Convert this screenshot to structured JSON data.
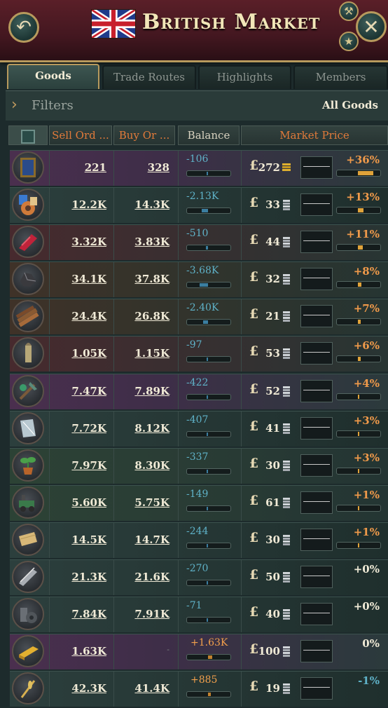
{
  "header": {
    "title": "British Market",
    "back_icon": "↶",
    "close_icon": "✕",
    "hammer_icon": "⚒",
    "star_icon": "★"
  },
  "tabs": [
    {
      "label": "Goods",
      "active": true
    },
    {
      "label": "Trade Routes",
      "active": false
    },
    {
      "label": "Highlights",
      "active": false
    },
    {
      "label": "Members",
      "active": false
    }
  ],
  "filters": {
    "label": "Filters",
    "value": "All Goods"
  },
  "columns": {
    "sell": "Sell Ord ...",
    "buy": "Buy Or ...",
    "balance": "Balance",
    "market_price": "Market Price"
  },
  "currency_symbol": "£",
  "goods": [
    {
      "icon": "painting-icon",
      "bg": "purple",
      "sell": "221",
      "buy": "328",
      "balance": "-106",
      "bal_level": 0.04,
      "bal_sign": "neg",
      "price": "272",
      "coin": "gold",
      "pct": "+36%",
      "pct_level": 0.36,
      "pct_type": "pos"
    },
    {
      "icon": "groceries-icon",
      "bg": "normal",
      "sell": "12.2K",
      "buy": "14.3K",
      "balance": "-2.13K",
      "bal_level": 0.15,
      "bal_sign": "neg",
      "price": "33",
      "coin": "silver",
      "pct": "+13%",
      "pct_level": 0.13,
      "pct_type": "pos"
    },
    {
      "icon": "fabric-icon",
      "bg": "red",
      "sell": "3.32K",
      "buy": "3.83K",
      "balance": "-510",
      "bal_level": 0.05,
      "bal_sign": "neg",
      "price": "44",
      "coin": "silver",
      "pct": "+11%",
      "pct_level": 0.11,
      "pct_type": "pos"
    },
    {
      "icon": "coal-icon",
      "bg": "brown",
      "sell": "34.1K",
      "buy": "37.8K",
      "balance": "-3.68K",
      "bal_level": 0.2,
      "bal_sign": "neg",
      "price": "32",
      "coin": "silver",
      "pct": "+8%",
      "pct_level": 0.08,
      "pct_type": "pos"
    },
    {
      "icon": "wood-icon",
      "bg": "brown",
      "sell": "24.4K",
      "buy": "26.8K",
      "balance": "-2.40K",
      "bal_level": 0.12,
      "bal_sign": "neg",
      "price": "21",
      "coin": "silver",
      "pct": "+7%",
      "pct_level": 0.07,
      "pct_type": "pos"
    },
    {
      "icon": "ammunition-icon",
      "bg": "red",
      "sell": "1.05K",
      "buy": "1.15K",
      "balance": "-97",
      "bal_level": 0.03,
      "bal_sign": "neg",
      "price": "53",
      "coin": "silver",
      "pct": "+6%",
      "pct_level": 0.06,
      "pct_type": "pos"
    },
    {
      "icon": "tools-icon",
      "bg": "purple",
      "sell": "7.47K",
      "buy": "7.89K",
      "balance": "-422",
      "bal_level": 0.04,
      "bal_sign": "neg",
      "price": "52",
      "coin": "silver",
      "pct": "+4%",
      "pct_level": 0.04,
      "pct_type": "pos"
    },
    {
      "icon": "glass-icon",
      "bg": "normal",
      "sell": "7.72K",
      "buy": "8.12K",
      "balance": "-407",
      "bal_level": 0.04,
      "bal_sign": "neg",
      "price": "41",
      "coin": "silver",
      "pct": "+3%",
      "pct_level": 0.03,
      "pct_type": "pos"
    },
    {
      "icon": "fertilizer-icon",
      "bg": "green",
      "sell": "7.97K",
      "buy": "8.30K",
      "balance": "-337",
      "bal_level": 0.04,
      "bal_sign": "neg",
      "price": "30",
      "coin": "silver",
      "pct": "+3%",
      "pct_level": 0.03,
      "pct_type": "pos"
    },
    {
      "icon": "engines-icon",
      "bg": "green",
      "sell": "5.60K",
      "buy": "5.75K",
      "balance": "-149",
      "bal_level": 0.03,
      "bal_sign": "neg",
      "price": "61",
      "coin": "silver",
      "pct": "+1%",
      "pct_level": 0.02,
      "pct_type": "pos"
    },
    {
      "icon": "paper-icon",
      "bg": "normal",
      "sell": "14.5K",
      "buy": "14.7K",
      "balance": "-244",
      "bal_level": 0.03,
      "bal_sign": "neg",
      "price": "30",
      "coin": "silver",
      "pct": "+1%",
      "pct_level": 0.02,
      "pct_type": "pos"
    },
    {
      "icon": "steel-icon",
      "bg": "normal",
      "sell": "21.3K",
      "buy": "21.6K",
      "balance": "-270",
      "bal_level": 0.03,
      "bal_sign": "neg",
      "price": "50",
      "coin": "silver",
      "pct": "+0%",
      "pct_level": 0,
      "pct_type": "zero"
    },
    {
      "icon": "iron-icon",
      "bg": "normal",
      "sell": "7.84K",
      "buy": "7.91K",
      "balance": "-71",
      "bal_level": 0.02,
      "bal_sign": "neg",
      "price": "40",
      "coin": "silver",
      "pct": "+0%",
      "pct_level": 0,
      "pct_type": "zero"
    },
    {
      "icon": "gold-icon",
      "bg": "purple",
      "sell": "1.63K",
      "buy": "-",
      "balance": "+1.63K",
      "bal_level": 0.1,
      "bal_sign": "pos",
      "price": "100",
      "coin": "silver",
      "pct": "0%",
      "pct_level": 0,
      "pct_type": "zero"
    },
    {
      "icon": "grain-icon",
      "bg": "normal",
      "sell": "42.3K",
      "buy": "41.4K",
      "balance": "+885",
      "bal_level": 0.06,
      "bal_sign": "pos",
      "price": "19",
      "coin": "silver",
      "pct": "-1%",
      "pct_level": 0,
      "pct_type": "neg"
    }
  ]
}
